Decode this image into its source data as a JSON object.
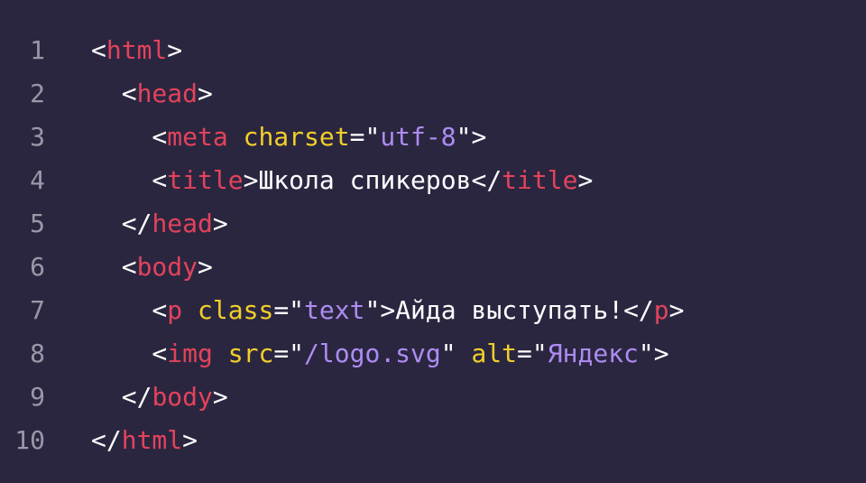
{
  "colors": {
    "background": "#2b2640",
    "line_number": "#9a98a8",
    "punctuation": "#ffffff",
    "tag": "#e2435b",
    "attribute": "#f1cf2a",
    "string": "#ad8cf2",
    "text": "#ffffff"
  },
  "lines": [
    {
      "n": "1",
      "tokens": [
        {
          "k": "p",
          "v": "<"
        },
        {
          "k": "t",
          "v": "html"
        },
        {
          "k": "p",
          "v": ">"
        }
      ]
    },
    {
      "n": "2",
      "tokens": [
        {
          "k": "p",
          "v": "  <"
        },
        {
          "k": "t",
          "v": "head"
        },
        {
          "k": "p",
          "v": ">"
        }
      ]
    },
    {
      "n": "3",
      "tokens": [
        {
          "k": "p",
          "v": "    <"
        },
        {
          "k": "t",
          "v": "meta"
        },
        {
          "k": "p",
          "v": " "
        },
        {
          "k": "a",
          "v": "charset"
        },
        {
          "k": "p",
          "v": "=\""
        },
        {
          "k": "s",
          "v": "utf-8"
        },
        {
          "k": "p",
          "v": "\">"
        }
      ]
    },
    {
      "n": "4",
      "tokens": [
        {
          "k": "p",
          "v": "    <"
        },
        {
          "k": "t",
          "v": "title"
        },
        {
          "k": "p",
          "v": ">"
        },
        {
          "k": "x",
          "v": "Школа спикеров"
        },
        {
          "k": "p",
          "v": "</"
        },
        {
          "k": "t",
          "v": "title"
        },
        {
          "k": "p",
          "v": ">"
        }
      ]
    },
    {
      "n": "5",
      "tokens": [
        {
          "k": "p",
          "v": "  </"
        },
        {
          "k": "t",
          "v": "head"
        },
        {
          "k": "p",
          "v": ">"
        }
      ]
    },
    {
      "n": "6",
      "tokens": [
        {
          "k": "p",
          "v": "  <"
        },
        {
          "k": "t",
          "v": "body"
        },
        {
          "k": "p",
          "v": ">"
        }
      ]
    },
    {
      "n": "7",
      "tokens": [
        {
          "k": "p",
          "v": "    <"
        },
        {
          "k": "t",
          "v": "p"
        },
        {
          "k": "p",
          "v": " "
        },
        {
          "k": "a",
          "v": "class"
        },
        {
          "k": "p",
          "v": "=\""
        },
        {
          "k": "s",
          "v": "text"
        },
        {
          "k": "p",
          "v": "\">"
        },
        {
          "k": "x",
          "v": "Айда выступать!"
        },
        {
          "k": "p",
          "v": "</"
        },
        {
          "k": "t",
          "v": "p"
        },
        {
          "k": "p",
          "v": ">"
        }
      ]
    },
    {
      "n": "8",
      "tokens": [
        {
          "k": "p",
          "v": "    <"
        },
        {
          "k": "t",
          "v": "img"
        },
        {
          "k": "p",
          "v": " "
        },
        {
          "k": "a",
          "v": "src"
        },
        {
          "k": "p",
          "v": "=\""
        },
        {
          "k": "s",
          "v": "/logo.svg"
        },
        {
          "k": "p",
          "v": "\" "
        },
        {
          "k": "a",
          "v": "alt"
        },
        {
          "k": "p",
          "v": "=\""
        },
        {
          "k": "s",
          "v": "Яндекс"
        },
        {
          "k": "p",
          "v": "\">"
        }
      ]
    },
    {
      "n": "9",
      "tokens": [
        {
          "k": "p",
          "v": "  </"
        },
        {
          "k": "t",
          "v": "body"
        },
        {
          "k": "p",
          "v": ">"
        }
      ]
    },
    {
      "n": "10",
      "tokens": [
        {
          "k": "p",
          "v": "</"
        },
        {
          "k": "t",
          "v": "html"
        },
        {
          "k": "p",
          "v": ">"
        }
      ]
    }
  ]
}
